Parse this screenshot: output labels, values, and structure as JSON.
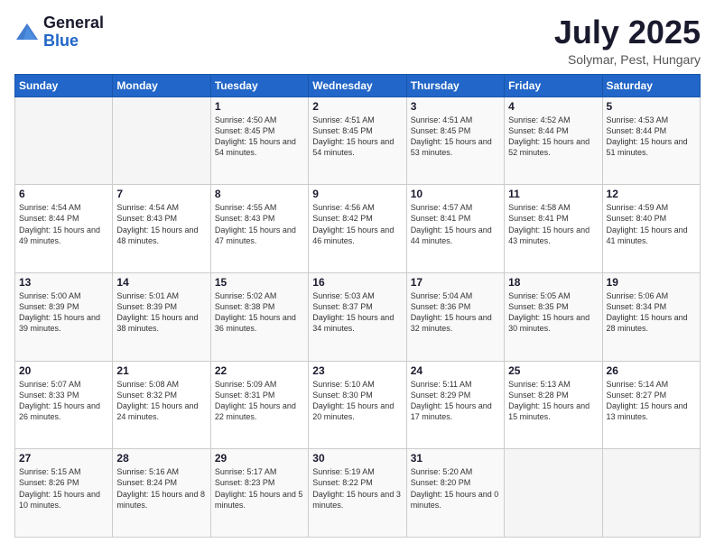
{
  "logo": {
    "general": "General",
    "blue": "Blue"
  },
  "header": {
    "title": "July 2025",
    "subtitle": "Solymar, Pest, Hungary"
  },
  "days_of_week": [
    "Sunday",
    "Monday",
    "Tuesday",
    "Wednesday",
    "Thursday",
    "Friday",
    "Saturday"
  ],
  "weeks": [
    [
      {
        "day": "",
        "empty": true
      },
      {
        "day": "",
        "empty": true
      },
      {
        "day": "1",
        "sunrise": "Sunrise: 4:50 AM",
        "sunset": "Sunset: 8:45 PM",
        "daylight": "Daylight: 15 hours and 54 minutes."
      },
      {
        "day": "2",
        "sunrise": "Sunrise: 4:51 AM",
        "sunset": "Sunset: 8:45 PM",
        "daylight": "Daylight: 15 hours and 54 minutes."
      },
      {
        "day": "3",
        "sunrise": "Sunrise: 4:51 AM",
        "sunset": "Sunset: 8:45 PM",
        "daylight": "Daylight: 15 hours and 53 minutes."
      },
      {
        "day": "4",
        "sunrise": "Sunrise: 4:52 AM",
        "sunset": "Sunset: 8:44 PM",
        "daylight": "Daylight: 15 hours and 52 minutes."
      },
      {
        "day": "5",
        "sunrise": "Sunrise: 4:53 AM",
        "sunset": "Sunset: 8:44 PM",
        "daylight": "Daylight: 15 hours and 51 minutes."
      }
    ],
    [
      {
        "day": "6",
        "sunrise": "Sunrise: 4:54 AM",
        "sunset": "Sunset: 8:44 PM",
        "daylight": "Daylight: 15 hours and 49 minutes."
      },
      {
        "day": "7",
        "sunrise": "Sunrise: 4:54 AM",
        "sunset": "Sunset: 8:43 PM",
        "daylight": "Daylight: 15 hours and 48 minutes."
      },
      {
        "day": "8",
        "sunrise": "Sunrise: 4:55 AM",
        "sunset": "Sunset: 8:43 PM",
        "daylight": "Daylight: 15 hours and 47 minutes."
      },
      {
        "day": "9",
        "sunrise": "Sunrise: 4:56 AM",
        "sunset": "Sunset: 8:42 PM",
        "daylight": "Daylight: 15 hours and 46 minutes."
      },
      {
        "day": "10",
        "sunrise": "Sunrise: 4:57 AM",
        "sunset": "Sunset: 8:41 PM",
        "daylight": "Daylight: 15 hours and 44 minutes."
      },
      {
        "day": "11",
        "sunrise": "Sunrise: 4:58 AM",
        "sunset": "Sunset: 8:41 PM",
        "daylight": "Daylight: 15 hours and 43 minutes."
      },
      {
        "day": "12",
        "sunrise": "Sunrise: 4:59 AM",
        "sunset": "Sunset: 8:40 PM",
        "daylight": "Daylight: 15 hours and 41 minutes."
      }
    ],
    [
      {
        "day": "13",
        "sunrise": "Sunrise: 5:00 AM",
        "sunset": "Sunset: 8:39 PM",
        "daylight": "Daylight: 15 hours and 39 minutes."
      },
      {
        "day": "14",
        "sunrise": "Sunrise: 5:01 AM",
        "sunset": "Sunset: 8:39 PM",
        "daylight": "Daylight: 15 hours and 38 minutes."
      },
      {
        "day": "15",
        "sunrise": "Sunrise: 5:02 AM",
        "sunset": "Sunset: 8:38 PM",
        "daylight": "Daylight: 15 hours and 36 minutes."
      },
      {
        "day": "16",
        "sunrise": "Sunrise: 5:03 AM",
        "sunset": "Sunset: 8:37 PM",
        "daylight": "Daylight: 15 hours and 34 minutes."
      },
      {
        "day": "17",
        "sunrise": "Sunrise: 5:04 AM",
        "sunset": "Sunset: 8:36 PM",
        "daylight": "Daylight: 15 hours and 32 minutes."
      },
      {
        "day": "18",
        "sunrise": "Sunrise: 5:05 AM",
        "sunset": "Sunset: 8:35 PM",
        "daylight": "Daylight: 15 hours and 30 minutes."
      },
      {
        "day": "19",
        "sunrise": "Sunrise: 5:06 AM",
        "sunset": "Sunset: 8:34 PM",
        "daylight": "Daylight: 15 hours and 28 minutes."
      }
    ],
    [
      {
        "day": "20",
        "sunrise": "Sunrise: 5:07 AM",
        "sunset": "Sunset: 8:33 PM",
        "daylight": "Daylight: 15 hours and 26 minutes."
      },
      {
        "day": "21",
        "sunrise": "Sunrise: 5:08 AM",
        "sunset": "Sunset: 8:32 PM",
        "daylight": "Daylight: 15 hours and 24 minutes."
      },
      {
        "day": "22",
        "sunrise": "Sunrise: 5:09 AM",
        "sunset": "Sunset: 8:31 PM",
        "daylight": "Daylight: 15 hours and 22 minutes."
      },
      {
        "day": "23",
        "sunrise": "Sunrise: 5:10 AM",
        "sunset": "Sunset: 8:30 PM",
        "daylight": "Daylight: 15 hours and 20 minutes."
      },
      {
        "day": "24",
        "sunrise": "Sunrise: 5:11 AM",
        "sunset": "Sunset: 8:29 PM",
        "daylight": "Daylight: 15 hours and 17 minutes."
      },
      {
        "day": "25",
        "sunrise": "Sunrise: 5:13 AM",
        "sunset": "Sunset: 8:28 PM",
        "daylight": "Daylight: 15 hours and 15 minutes."
      },
      {
        "day": "26",
        "sunrise": "Sunrise: 5:14 AM",
        "sunset": "Sunset: 8:27 PM",
        "daylight": "Daylight: 15 hours and 13 minutes."
      }
    ],
    [
      {
        "day": "27",
        "sunrise": "Sunrise: 5:15 AM",
        "sunset": "Sunset: 8:26 PM",
        "daylight": "Daylight: 15 hours and 10 minutes."
      },
      {
        "day": "28",
        "sunrise": "Sunrise: 5:16 AM",
        "sunset": "Sunset: 8:24 PM",
        "daylight": "Daylight: 15 hours and 8 minutes."
      },
      {
        "day": "29",
        "sunrise": "Sunrise: 5:17 AM",
        "sunset": "Sunset: 8:23 PM",
        "daylight": "Daylight: 15 hours and 5 minutes."
      },
      {
        "day": "30",
        "sunrise": "Sunrise: 5:19 AM",
        "sunset": "Sunset: 8:22 PM",
        "daylight": "Daylight: 15 hours and 3 minutes."
      },
      {
        "day": "31",
        "sunrise": "Sunrise: 5:20 AM",
        "sunset": "Sunset: 8:20 PM",
        "daylight": "Daylight: 15 hours and 0 minutes."
      },
      {
        "day": "",
        "empty": true
      },
      {
        "day": "",
        "empty": true
      }
    ]
  ]
}
